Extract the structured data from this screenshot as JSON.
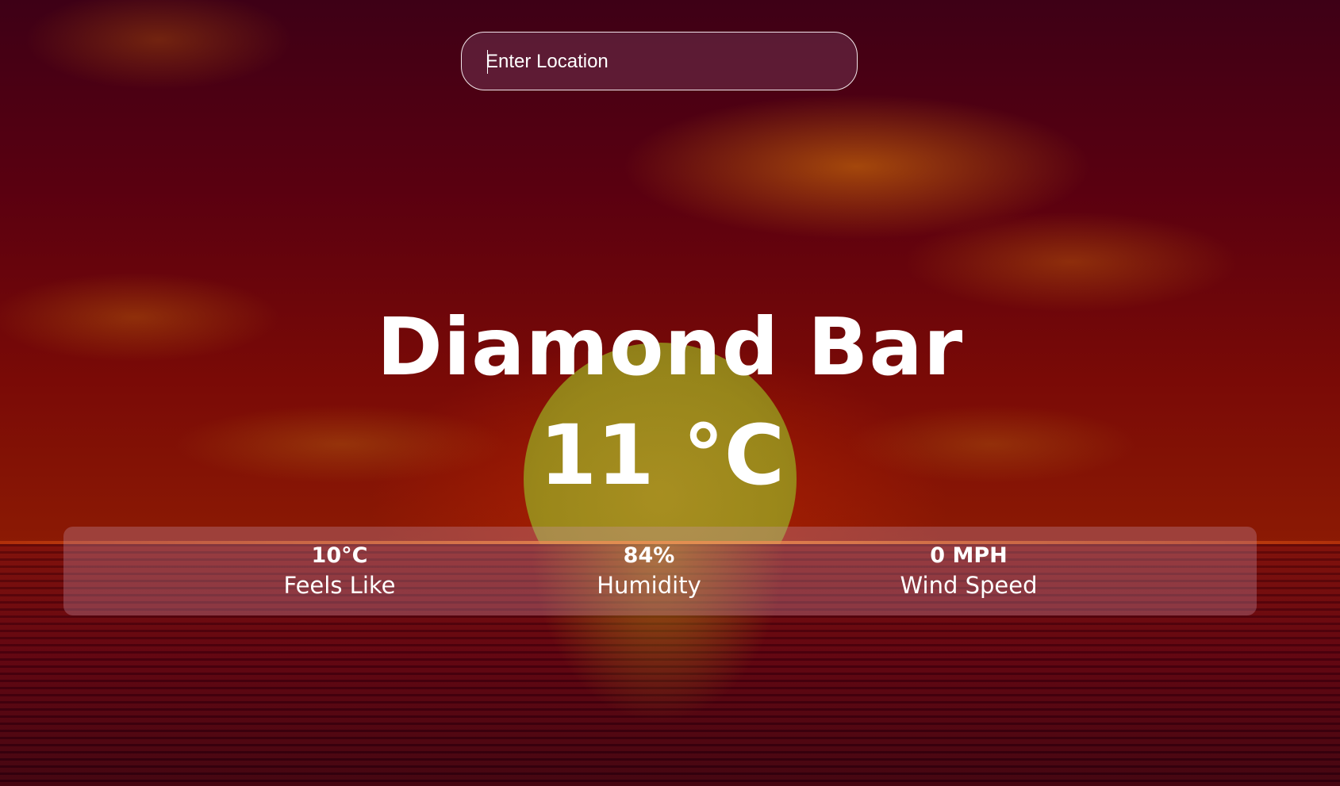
{
  "search": {
    "placeholder": "Enter Location",
    "value": ""
  },
  "weather": {
    "city": "Diamond Bar",
    "temperature": "11 °C"
  },
  "details": {
    "feels_like": {
      "value": "10°C",
      "label": "Feels Like"
    },
    "humidity": {
      "value": "84%",
      "label": "Humidity"
    },
    "wind_speed": {
      "value": "0 MPH",
      "label": "Wind Speed"
    }
  }
}
